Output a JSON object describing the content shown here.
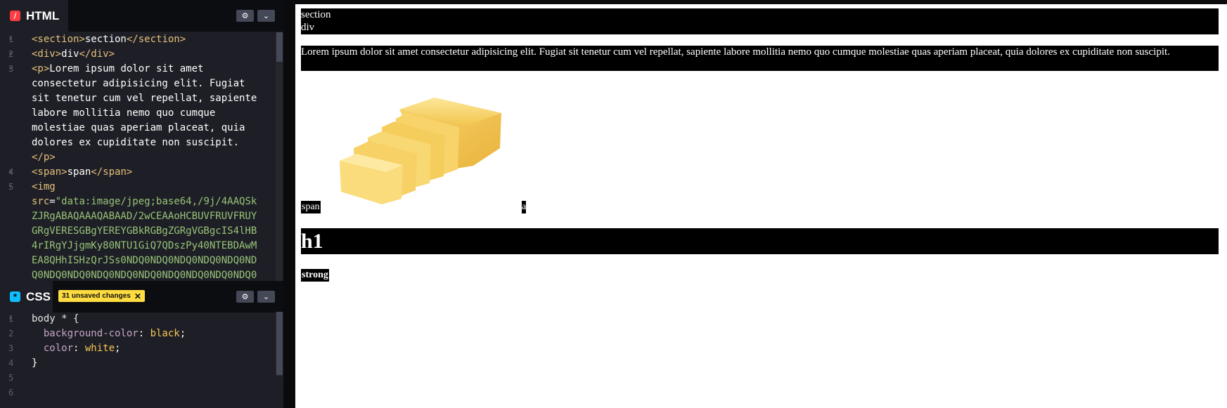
{
  "html_panel": {
    "title": "HTML",
    "icon": "html-icon",
    "code_lines": [
      {
        "n": "1",
        "parts": [
          [
            "tag",
            "<section>"
          ],
          [
            "txt",
            "section"
          ],
          [
            "tag",
            "</section>"
          ]
        ]
      },
      {
        "n": "2",
        "parts": [
          [
            "tag",
            "<div>"
          ],
          [
            "txt",
            "div"
          ],
          [
            "tag",
            "</div>"
          ]
        ]
      },
      {
        "n": "3",
        "parts": [
          [
            "tag",
            "<p>"
          ],
          [
            "txt",
            "Lorem ipsum dolor sit amet"
          ]
        ]
      },
      {
        "n": "",
        "parts": [
          [
            "txt",
            "consectetur adipisicing elit. Fugiat"
          ]
        ]
      },
      {
        "n": "",
        "parts": [
          [
            "txt",
            "sit tenetur cum vel repellat, sapiente"
          ]
        ]
      },
      {
        "n": "",
        "parts": [
          [
            "txt",
            "labore mollitia nemo quo cumque"
          ]
        ]
      },
      {
        "n": "",
        "parts": [
          [
            "txt",
            "molestiae quas aperiam placeat, quia"
          ]
        ]
      },
      {
        "n": "",
        "parts": [
          [
            "txt",
            "dolores ex cupiditate non suscipit."
          ]
        ]
      },
      {
        "n": "",
        "parts": [
          [
            "tag",
            "</p>"
          ]
        ]
      },
      {
        "n": "4",
        "parts": [
          [
            "tag",
            "<span>"
          ],
          [
            "txt",
            "span"
          ],
          [
            "tag",
            "</span>"
          ]
        ]
      },
      {
        "n": "5",
        "parts": [
          [
            "tag",
            "<img"
          ]
        ]
      },
      {
        "n": "",
        "parts": [
          [
            "attr",
            "src"
          ],
          [
            "txt",
            "="
          ],
          [
            "str",
            "\"data:image/jpeg;base64,/9j/4AAQSk"
          ]
        ]
      },
      {
        "n": "",
        "parts": [
          [
            "str",
            "ZJRgABAQAAAQABAAD/2wCEAAoHCBUVFRUVFRUY"
          ]
        ]
      },
      {
        "n": "",
        "parts": [
          [
            "str",
            "GRgVERESGBgYEREYGBkRGBgZGRgVGBgcIS4lHB"
          ]
        ]
      },
      {
        "n": "",
        "parts": [
          [
            "str",
            "4rIRgYJjgmKy80NTU1GiQ7QDszPy40NTEBDAwM"
          ]
        ]
      },
      {
        "n": "",
        "parts": [
          [
            "str",
            "EA8QHhISHzQrJSs0NDQ0NDQ0NDQ0NDQ0NDQ0ND"
          ]
        ]
      },
      {
        "n": "",
        "parts": [
          [
            "str",
            "Q0NDQ0NDQ0NDQ0NDQ0NDQ0NDQ0NDQ0NDQ0NDQ0"
          ]
        ]
      }
    ]
  },
  "css_panel": {
    "title": "CSS",
    "icon": "css-icon",
    "unsaved_badge": "31 unsaved changes",
    "code_lines": [
      {
        "n": "1",
        "parts": [
          [
            "sel",
            "body * {"
          ]
        ]
      },
      {
        "n": "2",
        "parts": [
          [
            "prop",
            "  background-color"
          ],
          [
            "txt",
            ": "
          ],
          [
            "val",
            "black"
          ],
          [
            "txt",
            ";"
          ]
        ]
      },
      {
        "n": "3",
        "parts": [
          [
            "prop",
            "  color"
          ],
          [
            "txt",
            ": "
          ],
          [
            "val",
            "white"
          ],
          [
            "txt",
            ";"
          ]
        ]
      },
      {
        "n": "4",
        "parts": [
          [
            "txt",
            "}"
          ]
        ]
      },
      {
        "n": "5",
        "parts": []
      },
      {
        "n": "6",
        "parts": []
      }
    ]
  },
  "preview": {
    "section_text": "section",
    "div_text": "div",
    "p_text": "Lorem ipsum dolor sit amet consectetur adipisicing elit. Fugiat sit tenetur cum vel repellat, sapiente labore mollitia nemo quo cumque molestiae quas aperiam placeat, quia dolores ex cupiditate non suscipit.",
    "span_text": "span",
    "a_text": "a",
    "h1_text": "h1",
    "strong_text": "strong",
    "image_icon": "butter-image"
  },
  "colors": {
    "editor_bg": "#1e1f26",
    "html_icon": "#ff3c41",
    "css_icon": "#0ebeff",
    "badge": "#ffdd40"
  }
}
